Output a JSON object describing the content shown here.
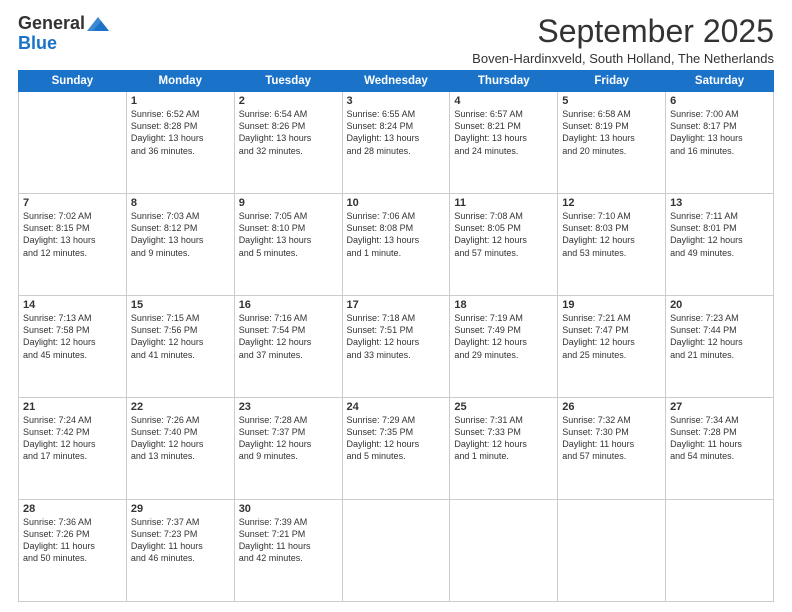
{
  "logo": {
    "general": "General",
    "blue": "Blue"
  },
  "title": "September 2025",
  "location": "Boven-Hardinxveld, South Holland, The Netherlands",
  "days_of_week": [
    "Sunday",
    "Monday",
    "Tuesday",
    "Wednesday",
    "Thursday",
    "Friday",
    "Saturday"
  ],
  "weeks": [
    [
      {
        "day": "",
        "info": ""
      },
      {
        "day": "1",
        "info": "Sunrise: 6:52 AM\nSunset: 8:28 PM\nDaylight: 13 hours\nand 36 minutes."
      },
      {
        "day": "2",
        "info": "Sunrise: 6:54 AM\nSunset: 8:26 PM\nDaylight: 13 hours\nand 32 minutes."
      },
      {
        "day": "3",
        "info": "Sunrise: 6:55 AM\nSunset: 8:24 PM\nDaylight: 13 hours\nand 28 minutes."
      },
      {
        "day": "4",
        "info": "Sunrise: 6:57 AM\nSunset: 8:21 PM\nDaylight: 13 hours\nand 24 minutes."
      },
      {
        "day": "5",
        "info": "Sunrise: 6:58 AM\nSunset: 8:19 PM\nDaylight: 13 hours\nand 20 minutes."
      },
      {
        "day": "6",
        "info": "Sunrise: 7:00 AM\nSunset: 8:17 PM\nDaylight: 13 hours\nand 16 minutes."
      }
    ],
    [
      {
        "day": "7",
        "info": "Sunrise: 7:02 AM\nSunset: 8:15 PM\nDaylight: 13 hours\nand 12 minutes."
      },
      {
        "day": "8",
        "info": "Sunrise: 7:03 AM\nSunset: 8:12 PM\nDaylight: 13 hours\nand 9 minutes."
      },
      {
        "day": "9",
        "info": "Sunrise: 7:05 AM\nSunset: 8:10 PM\nDaylight: 13 hours\nand 5 minutes."
      },
      {
        "day": "10",
        "info": "Sunrise: 7:06 AM\nSunset: 8:08 PM\nDaylight: 13 hours\nand 1 minute."
      },
      {
        "day": "11",
        "info": "Sunrise: 7:08 AM\nSunset: 8:05 PM\nDaylight: 12 hours\nand 57 minutes."
      },
      {
        "day": "12",
        "info": "Sunrise: 7:10 AM\nSunset: 8:03 PM\nDaylight: 12 hours\nand 53 minutes."
      },
      {
        "day": "13",
        "info": "Sunrise: 7:11 AM\nSunset: 8:01 PM\nDaylight: 12 hours\nand 49 minutes."
      }
    ],
    [
      {
        "day": "14",
        "info": "Sunrise: 7:13 AM\nSunset: 7:58 PM\nDaylight: 12 hours\nand 45 minutes."
      },
      {
        "day": "15",
        "info": "Sunrise: 7:15 AM\nSunset: 7:56 PM\nDaylight: 12 hours\nand 41 minutes."
      },
      {
        "day": "16",
        "info": "Sunrise: 7:16 AM\nSunset: 7:54 PM\nDaylight: 12 hours\nand 37 minutes."
      },
      {
        "day": "17",
        "info": "Sunrise: 7:18 AM\nSunset: 7:51 PM\nDaylight: 12 hours\nand 33 minutes."
      },
      {
        "day": "18",
        "info": "Sunrise: 7:19 AM\nSunset: 7:49 PM\nDaylight: 12 hours\nand 29 minutes."
      },
      {
        "day": "19",
        "info": "Sunrise: 7:21 AM\nSunset: 7:47 PM\nDaylight: 12 hours\nand 25 minutes."
      },
      {
        "day": "20",
        "info": "Sunrise: 7:23 AM\nSunset: 7:44 PM\nDaylight: 12 hours\nand 21 minutes."
      }
    ],
    [
      {
        "day": "21",
        "info": "Sunrise: 7:24 AM\nSunset: 7:42 PM\nDaylight: 12 hours\nand 17 minutes."
      },
      {
        "day": "22",
        "info": "Sunrise: 7:26 AM\nSunset: 7:40 PM\nDaylight: 12 hours\nand 13 minutes."
      },
      {
        "day": "23",
        "info": "Sunrise: 7:28 AM\nSunset: 7:37 PM\nDaylight: 12 hours\nand 9 minutes."
      },
      {
        "day": "24",
        "info": "Sunrise: 7:29 AM\nSunset: 7:35 PM\nDaylight: 12 hours\nand 5 minutes."
      },
      {
        "day": "25",
        "info": "Sunrise: 7:31 AM\nSunset: 7:33 PM\nDaylight: 12 hours\nand 1 minute."
      },
      {
        "day": "26",
        "info": "Sunrise: 7:32 AM\nSunset: 7:30 PM\nDaylight: 11 hours\nand 57 minutes."
      },
      {
        "day": "27",
        "info": "Sunrise: 7:34 AM\nSunset: 7:28 PM\nDaylight: 11 hours\nand 54 minutes."
      }
    ],
    [
      {
        "day": "28",
        "info": "Sunrise: 7:36 AM\nSunset: 7:26 PM\nDaylight: 11 hours\nand 50 minutes."
      },
      {
        "day": "29",
        "info": "Sunrise: 7:37 AM\nSunset: 7:23 PM\nDaylight: 11 hours\nand 46 minutes."
      },
      {
        "day": "30",
        "info": "Sunrise: 7:39 AM\nSunset: 7:21 PM\nDaylight: 11 hours\nand 42 minutes."
      },
      {
        "day": "",
        "info": ""
      },
      {
        "day": "",
        "info": ""
      },
      {
        "day": "",
        "info": ""
      },
      {
        "day": "",
        "info": ""
      }
    ]
  ]
}
